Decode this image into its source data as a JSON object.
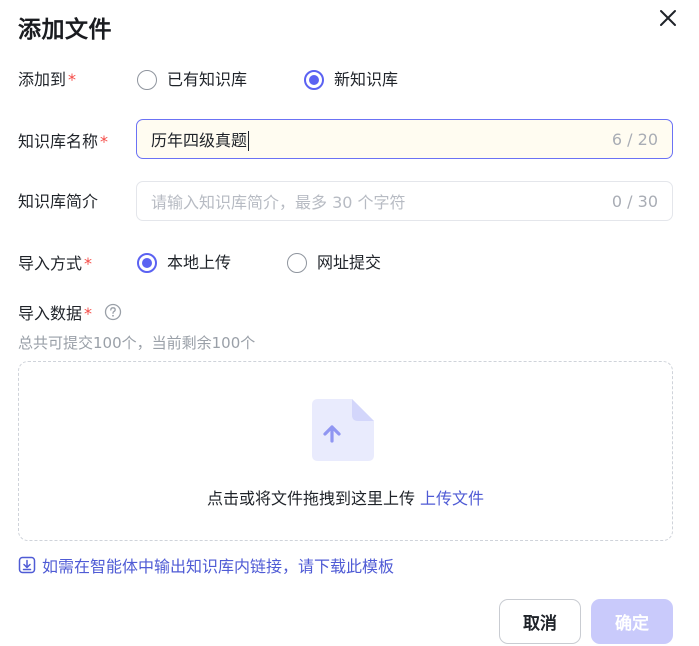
{
  "dialog": {
    "title": "添加文件"
  },
  "add_to": {
    "label": "添加到",
    "required_mark": "*",
    "options": [
      {
        "label": "已有知识库",
        "checked": false
      },
      {
        "label": "新知识库",
        "checked": true
      }
    ]
  },
  "kb_name": {
    "label": "知识库名称",
    "required_mark": "*",
    "value": "历年四级真题",
    "counter": "6 / 20"
  },
  "kb_desc": {
    "label": "知识库简介",
    "placeholder": "请输入知识库简介，最多 30  个字符",
    "counter": "0 / 30"
  },
  "import_method": {
    "label": "导入方式",
    "required_mark": "*",
    "options": [
      {
        "label": "本地上传",
        "checked": true
      },
      {
        "label": "网址提交",
        "checked": false
      }
    ]
  },
  "import_data": {
    "label": "导入数据",
    "required_mark": "*",
    "hint": "总共可提交100个，当前剩余100个"
  },
  "dropzone": {
    "text": "点击或将文件拖拽到这里上传",
    "link": "上传文件"
  },
  "template": {
    "link": "如需在智能体中输出知识库内链接，请下载此模板"
  },
  "buttons": {
    "cancel": "取消",
    "ok": "确定"
  },
  "colors": {
    "accent": "#5b62f2",
    "link": "#4f5bd5",
    "required": "#f54a45",
    "ok_disabled": "#c9cafb"
  }
}
